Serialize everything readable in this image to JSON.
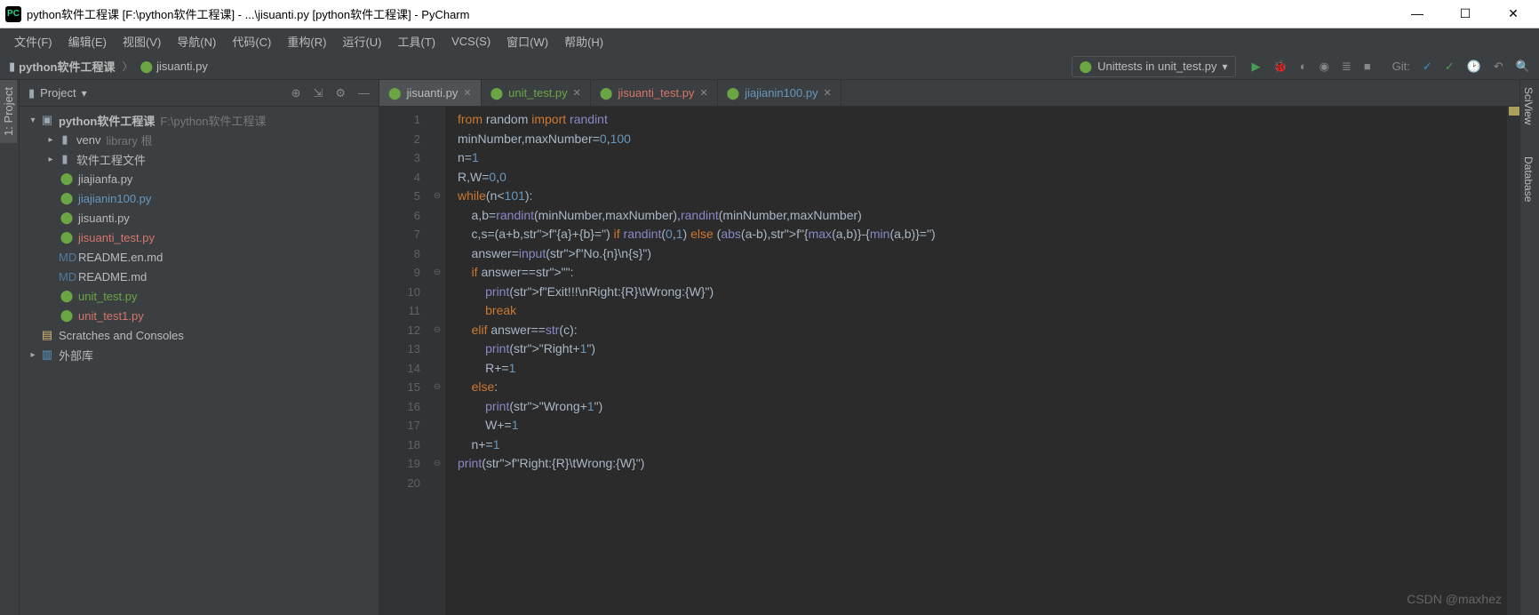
{
  "window": {
    "title": "python软件工程课 [F:\\python软件工程课] - ...\\jisuanti.py [python软件工程课] - PyCharm"
  },
  "menu": {
    "items": [
      "文件(F)",
      "编辑(E)",
      "视图(V)",
      "导航(N)",
      "代码(C)",
      "重构(R)",
      "运行(U)",
      "工具(T)",
      "VCS(S)",
      "窗口(W)",
      "帮助(H)"
    ]
  },
  "breadcrumb": {
    "root": "python软件工程课",
    "file": "jisuanti.py"
  },
  "run_config": {
    "label": "Unittests in unit_test.py"
  },
  "git_label": "Git:",
  "project_panel": {
    "title": "Project",
    "root": {
      "name": "python软件工程课",
      "path": "F:\\python软件工程课"
    },
    "folders": [
      {
        "name": "venv",
        "note": "library 根"
      },
      {
        "name": "软件工程文件",
        "note": ""
      }
    ],
    "files": [
      {
        "name": "jiajianfa.py",
        "cls": "file-normal",
        "icon": "py"
      },
      {
        "name": "jiajianin100.py",
        "cls": "file-blue",
        "icon": "py"
      },
      {
        "name": "jisuanti.py",
        "cls": "file-normal",
        "icon": "py"
      },
      {
        "name": "jisuanti_test.py",
        "cls": "file-red",
        "icon": "py"
      },
      {
        "name": "README.en.md",
        "cls": "file-normal",
        "icon": "md"
      },
      {
        "name": "README.md",
        "cls": "file-normal",
        "icon": "md"
      },
      {
        "name": "unit_test.py",
        "cls": "file-green",
        "icon": "py-green"
      },
      {
        "name": "unit_test1.py",
        "cls": "file-red",
        "icon": "py-green"
      }
    ],
    "scratches": "Scratches and Consoles",
    "external": "外部库"
  },
  "editor_tabs": [
    {
      "name": "jisuanti.py",
      "cls": "tab-normal",
      "active": true
    },
    {
      "name": "unit_test.py",
      "cls": "tab-green",
      "active": false
    },
    {
      "name": "jisuanti_test.py",
      "cls": "tab-red",
      "active": false
    },
    {
      "name": "jiajianin100.py",
      "cls": "tab-blue",
      "active": false
    }
  ],
  "code_lines": [
    "from random import randint",
    "minNumber,maxNumber=0,100",
    "n=1",
    "R,W=0,0",
    "while(n<101):",
    "    a,b=randint(minNumber,maxNumber),randint(minNumber,maxNumber)",
    "    c,s=(a+b,f\"{a}+{b}=\") if randint(0,1) else (abs(a-b),f\"{max(a,b)}-{min(a,b)}=\")",
    "    answer=input(f\"No.{n}\\n{s}\")",
    "    if answer==\"\":",
    "        print(f\"Exit!!!\\nRight:{R}\\tWrong:{W}\")",
    "        break",
    "    elif answer==str(c):",
    "        print(\"Right+1\")",
    "        R+=1",
    "    else:",
    "        print(\"Wrong+1\")",
    "        W+=1",
    "    n+=1",
    "print(f\"Right:{R}\\tWrong:{W}\")",
    ""
  ],
  "side_tabs": {
    "left_project": "1: Project",
    "right_sciview": "SciView",
    "right_database": "Database"
  },
  "watermark": "CSDN @maxhez"
}
